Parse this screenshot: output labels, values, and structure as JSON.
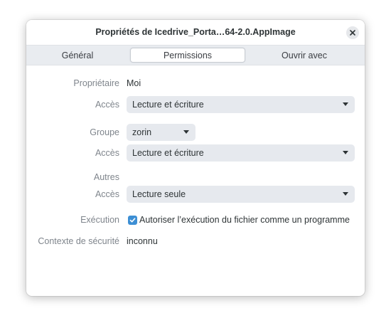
{
  "window": {
    "title": "Propriétés de Icedrive_Porta…64-2.0.AppImage"
  },
  "tabs": [
    {
      "label": "Général",
      "active": false
    },
    {
      "label": "Permissions",
      "active": true
    },
    {
      "label": "Ouvrir avec",
      "active": false
    }
  ],
  "owner": {
    "label": "Propriétaire",
    "value": "Moi",
    "access_label": "Accès",
    "access_value": "Lecture et écriture"
  },
  "group": {
    "label": "Groupe",
    "value": "zorin",
    "access_label": "Accès",
    "access_value": "Lecture et écriture"
  },
  "others": {
    "label": "Autres",
    "access_label": "Accès",
    "access_value": "Lecture seule"
  },
  "execution": {
    "label": "Exécution",
    "checkbox_label": "Autoriser l’exécution du fichier comme un programme",
    "checked": true
  },
  "security": {
    "label": "Contexte de sécurité",
    "value": "inconnu"
  },
  "colors": {
    "accent": "#3d8fd4",
    "combo_bg": "#e6e9ee",
    "tabbar_bg": "#e9ecf0"
  }
}
